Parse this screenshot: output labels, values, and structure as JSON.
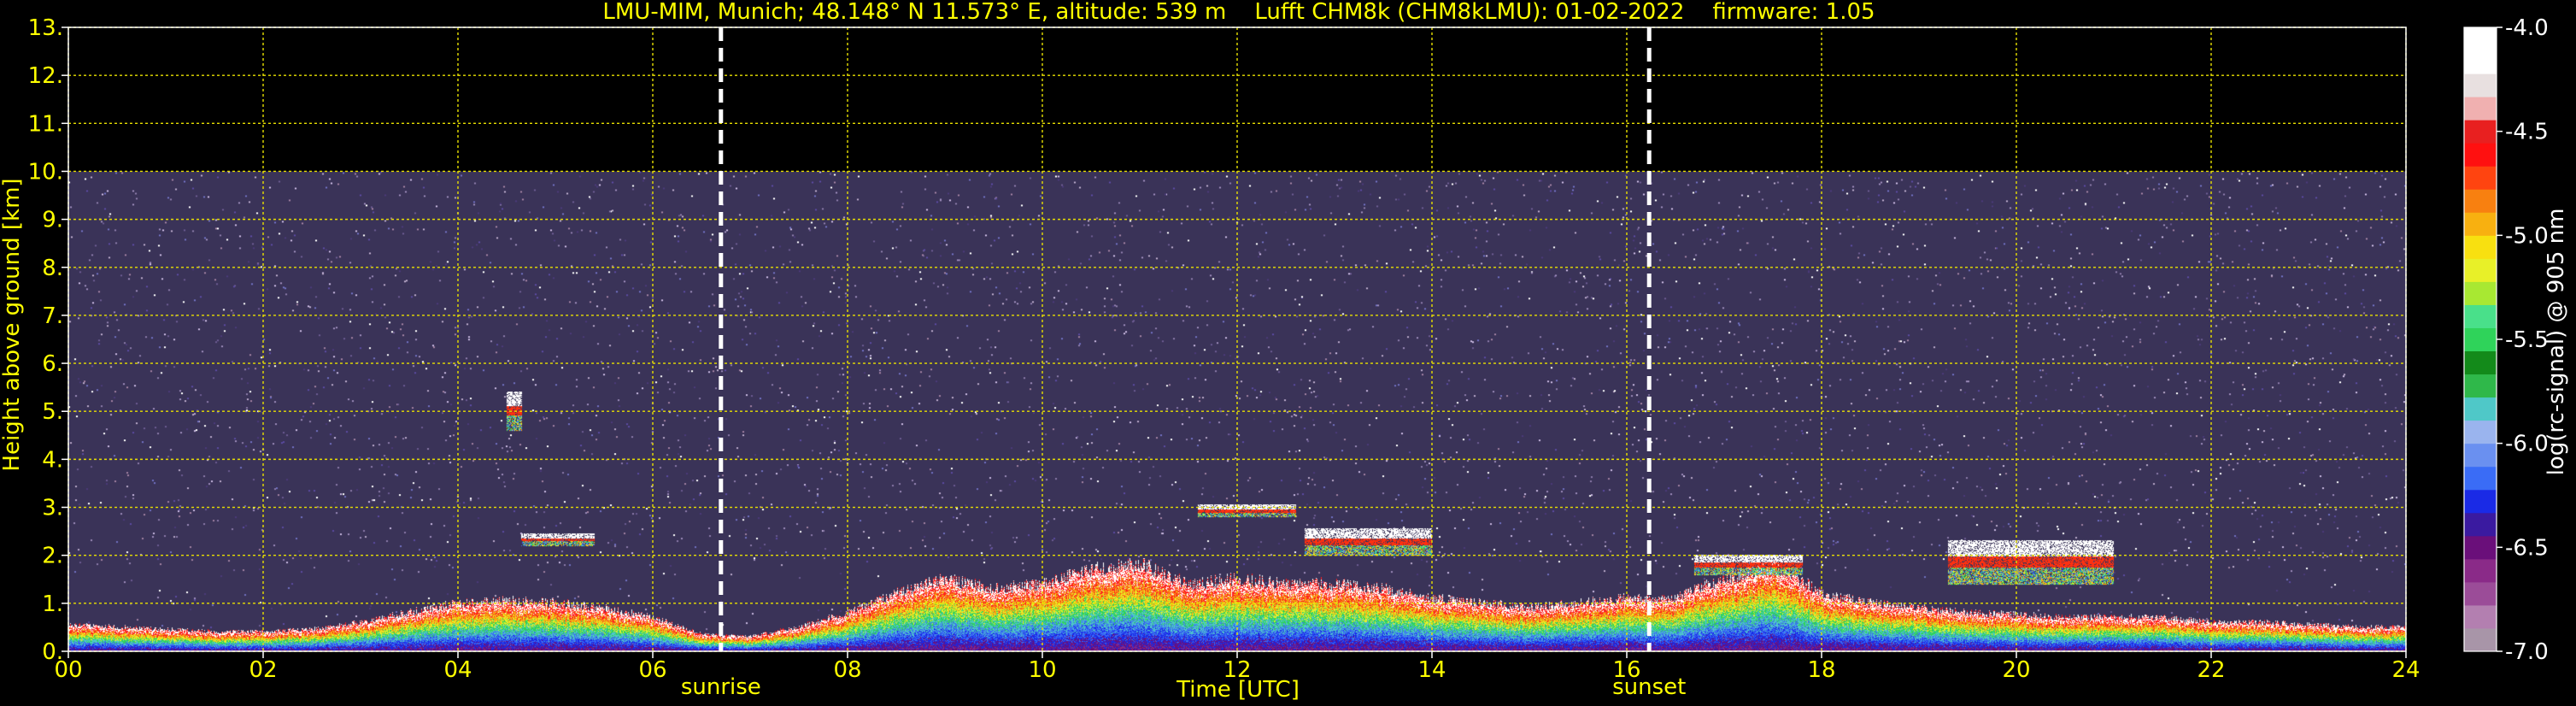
{
  "chart_data": {
    "type": "heatmap",
    "title": "LMU-MIM, Munich; 48.148° N 11.573° E, altitude: 539 m    Lufft CHM8k (CHM8kLMU): 01-02-2022    firmware: 1.05",
    "xlabel": "Time [UTC]",
    "ylabel": "Height above ground [km]",
    "xlim": [
      0,
      24
    ],
    "ylim": [
      0,
      13
    ],
    "x_ticks": [
      0,
      2,
      4,
      6,
      8,
      10,
      12,
      14,
      16,
      18,
      20,
      22,
      24
    ],
    "x_tick_labels": [
      "00",
      "02",
      "04",
      "06",
      "08",
      "10",
      "12",
      "14",
      "16",
      "18",
      "20",
      "22",
      "24"
    ],
    "y_ticks": [
      0,
      1,
      2,
      3,
      4,
      5,
      6,
      7,
      8,
      9,
      10,
      11,
      12,
      13
    ],
    "y_tick_labels": [
      "0.",
      "1.",
      "2.",
      "3.",
      "4.",
      "5.",
      "6.",
      "7.",
      "8.",
      "9.",
      "10.",
      "11.",
      "12.",
      "13."
    ],
    "grid": true,
    "max_range_km": 10,
    "event_lines": [
      {
        "label": "sunrise",
        "x": 6.7
      },
      {
        "label": "sunset",
        "x": 16.23
      }
    ],
    "colorbar": {
      "label": "log(rc-signal) @ 905 nm",
      "range": [
        -7.0,
        -4.0
      ],
      "ticks": [
        -4.0,
        -4.5,
        -5.0,
        -5.5,
        -6.0,
        -6.5,
        -7.0
      ],
      "tick_labels": [
        "-4.0",
        "-4.5",
        "-5.0",
        "-5.5",
        "-6.0",
        "-6.5",
        "-7.0"
      ],
      "colors": [
        "#a895a8",
        "#b37fb0",
        "#9b4c98",
        "#8a2a88",
        "#6a0f7a",
        "#3a1aa0",
        "#1a2ae6",
        "#3a6cf6",
        "#6a90f0",
        "#9ab4ee",
        "#4fc8c8",
        "#2fb84a",
        "#138a1a",
        "#2fd35a",
        "#49e08a",
        "#a8e832",
        "#e8f028",
        "#f8e010",
        "#f8b010",
        "#f88010",
        "#ff4410",
        "#ff1010",
        "#e82020",
        "#f0b0b0",
        "#e8e0e0",
        "#ffffff",
        "#ffffff"
      ]
    },
    "boundary_layer": {
      "x": [
        0,
        0.5,
        1,
        1.5,
        2,
        2.5,
        3,
        3.5,
        4,
        4.5,
        5,
        5.5,
        6,
        6.5,
        7,
        7.5,
        8,
        8.5,
        9,
        9.5,
        10,
        10.5,
        11,
        11.5,
        12,
        12.5,
        13,
        13.5,
        14,
        14.5,
        15,
        15.5,
        16,
        16.5,
        17,
        17.5,
        18,
        18.5,
        19,
        19.5,
        20,
        20.5,
        21,
        21.5,
        22,
        22.5,
        23,
        23.5,
        24
      ],
      "y": [
        0.55,
        0.5,
        0.45,
        0.4,
        0.4,
        0.45,
        0.6,
        0.8,
        1.0,
        1.05,
        1.0,
        0.9,
        0.7,
        0.35,
        0.3,
        0.5,
        0.8,
        1.2,
        1.5,
        1.3,
        1.4,
        1.7,
        1.8,
        1.4,
        1.5,
        1.4,
        1.4,
        1.3,
        1.1,
        1.0,
        0.9,
        1.0,
        1.1,
        1.1,
        1.5,
        1.8,
        1.2,
        1.0,
        0.9,
        0.8,
        0.75,
        0.7,
        0.7,
        0.7,
        0.6,
        0.6,
        0.55,
        0.5,
        0.5
      ]
    },
    "aerosol_layers": [
      {
        "x0": 4.5,
        "x1": 4.65,
        "y0": 4.6,
        "y1": 5.4
      },
      {
        "x0": 4.65,
        "x1": 5.4,
        "y0": 2.2,
        "y1": 2.45
      },
      {
        "x0": 11.6,
        "x1": 12.6,
        "y0": 2.8,
        "y1": 3.05
      },
      {
        "x0": 12.7,
        "x1": 14.0,
        "y0": 2.0,
        "y1": 2.55
      },
      {
        "x0": 16.7,
        "x1": 17.8,
        "y0": 1.6,
        "y1": 2.0
      },
      {
        "x0": 19.3,
        "x1": 21.0,
        "y0": 1.4,
        "y1": 2.3
      }
    ]
  }
}
